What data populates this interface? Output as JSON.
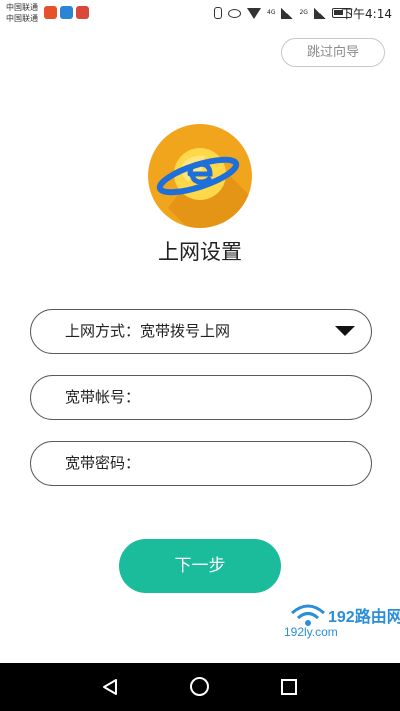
{
  "status_bar": {
    "carrier_line1": "中国联通",
    "carrier_line2": "中国联通",
    "network_badges": [
      "4G",
      "2G"
    ],
    "time": "下午4:14"
  },
  "header": {
    "skip_label": "跳过向导"
  },
  "main": {
    "title": "上网设置",
    "fields": {
      "connection_type": {
        "label": "上网方式：宽带拨号上网"
      },
      "account": {
        "label": "宽带帐号：",
        "value": ""
      },
      "password": {
        "label": "宽带密码：",
        "value": ""
      }
    },
    "next_label": "下一步"
  },
  "watermark": {
    "title": "192路由网",
    "url": "192ly.com"
  },
  "colors": {
    "accent": "#1abc9c",
    "logo_orange": "#f1a51d",
    "watermark_blue": "#2a8ed8"
  },
  "icons": {
    "nav": [
      "back-icon",
      "home-icon",
      "recent-apps-icon"
    ],
    "logo": "globe-e-logo"
  }
}
